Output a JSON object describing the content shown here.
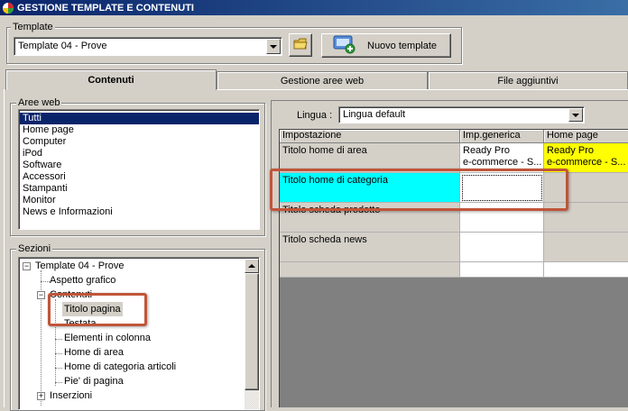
{
  "window": {
    "title": "GESTIONE TEMPLATE E CONTENUTI"
  },
  "template_group": {
    "label": "Template",
    "selected": "Template 04 - Prove",
    "new_button_label": "Nuovo template"
  },
  "tabs": [
    {
      "label": "Contenuti",
      "active": true
    },
    {
      "label": "Gestione aree web",
      "active": false
    },
    {
      "label": "File aggiuntivi",
      "active": false
    }
  ],
  "aree_web": {
    "label": "Aree web",
    "items": [
      "Tutti",
      "Home page",
      "Computer",
      "iPod",
      "Software",
      "Accessori",
      "Stampanti",
      "Monitor",
      "News e Informazioni"
    ],
    "selected_index": 0
  },
  "sezioni": {
    "label": "Sezioni",
    "tree": [
      {
        "label": "Template 04 - Prove",
        "expander": "−"
      },
      {
        "label": "Aspetto grafico"
      },
      {
        "label": "Contenuti",
        "expander": "−"
      },
      {
        "label": "Titolo pagina",
        "selected": true
      },
      {
        "label": "Testata"
      },
      {
        "label": "Elementi in colonna"
      },
      {
        "label": "Home di area"
      },
      {
        "label": "Home di categoria articoli"
      },
      {
        "label": "Pie' di pagina"
      },
      {
        "label": "Inserzioni",
        "expander": "+"
      }
    ]
  },
  "lingua": {
    "label": "Lingua :",
    "value": "Lingua default"
  },
  "grid": {
    "headers": [
      "Impostazione",
      "Imp.generica",
      "Home page"
    ],
    "rows": [
      {
        "name": "Titolo home di area",
        "generic": "Ready Pro\ne-commerce - S...",
        "home": "Ready Pro\ne-commerce - S..."
      },
      {
        "name": "Titolo home di categoria",
        "generic": "",
        "home": ""
      },
      {
        "name": "Titolo scheda prodotto",
        "generic": "",
        "home": ""
      },
      {
        "name": "Titolo scheda news",
        "generic": "",
        "home": ""
      }
    ],
    "colors": {
      "selected_name": "#00ffff",
      "home_value": "#ffff00",
      "empty_area": "#808080"
    }
  },
  "annotation_color": "#c0553a"
}
